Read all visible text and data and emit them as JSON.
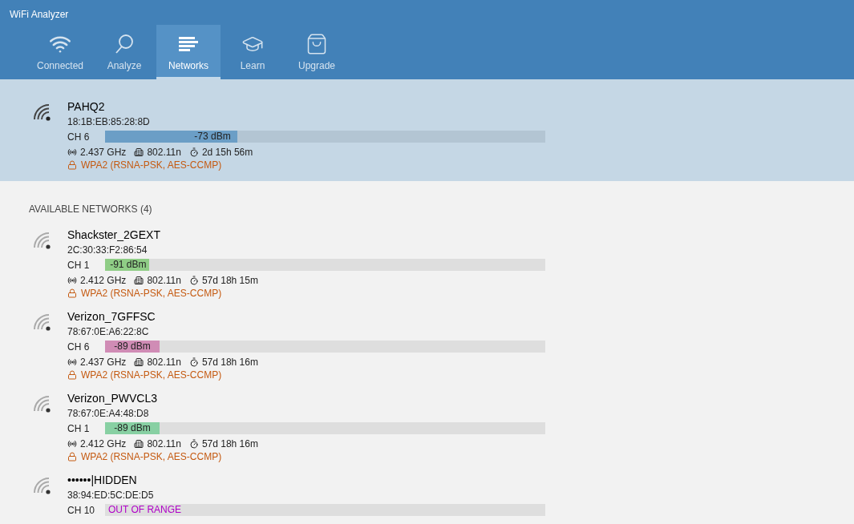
{
  "app_title": "WiFi Analyzer",
  "tabs": [
    {
      "label": "Connected",
      "selected": false
    },
    {
      "label": "Analyze",
      "selected": false
    },
    {
      "label": "Networks",
      "selected": true
    },
    {
      "label": "Learn",
      "selected": false
    },
    {
      "label": "Upgrade",
      "selected": false
    }
  ],
  "connected": {
    "name": "PAHQ2",
    "mac": "18:1B:EB:85:28:8D",
    "channel": "CH 6",
    "signal": {
      "kind": "in_range",
      "level": 0.3,
      "reading": "-73 dBm",
      "color": "#6b9ec6"
    },
    "frequency": "2.437 GHz",
    "standard": "802.11n",
    "uptime": "2d 15h 56m",
    "security": "WPA2 (RSNA-PSK, AES-CCMP)"
  },
  "section_title": "AVAILABLE NETWORKS (4)",
  "networks": [
    {
      "name": "Shackster_2GEXT",
      "mac": "2C:30:33:F2:86:54",
      "channel": "CH 1",
      "signal": {
        "kind": "in_range",
        "level": 0.1,
        "reading": "-91 dBm",
        "color": "#8fcd86"
      },
      "frequency": "2.412 GHz",
      "standard": "802.11n",
      "uptime": "57d 18h 15m",
      "security": "WPA2 (RSNA-PSK, AES-CCMP)"
    },
    {
      "name": "Verizon_7GFFSC",
      "mac": "78:67:0E:A6:22:8C",
      "channel": "CH 6",
      "signal": {
        "kind": "in_range",
        "level": 0.124,
        "reading": "-89 dBm",
        "color": "#d08cb5"
      },
      "frequency": "2.437 GHz",
      "standard": "802.11n",
      "uptime": "57d 18h 16m",
      "security": "WPA2 (RSNA-PSK, AES-CCMP)"
    },
    {
      "name": "Verizon_PWVCL3",
      "mac": "78:67:0E:A4:48:D8",
      "channel": "CH 1",
      "signal": {
        "kind": "in_range",
        "level": 0.124,
        "reading": "-89 dBm",
        "color": "#88d0a3"
      },
      "frequency": "2.412 GHz",
      "standard": "802.11n",
      "uptime": "57d 18h 16m",
      "security": "WPA2 (RSNA-PSK, AES-CCMP)"
    },
    {
      "name": "••••••|HIDDEN",
      "mac": "38:94:ED:5C:DE:D5",
      "channel": "CH 10",
      "signal": {
        "kind": "out_of_range",
        "reading": "OUT OF RANGE"
      }
    }
  ]
}
